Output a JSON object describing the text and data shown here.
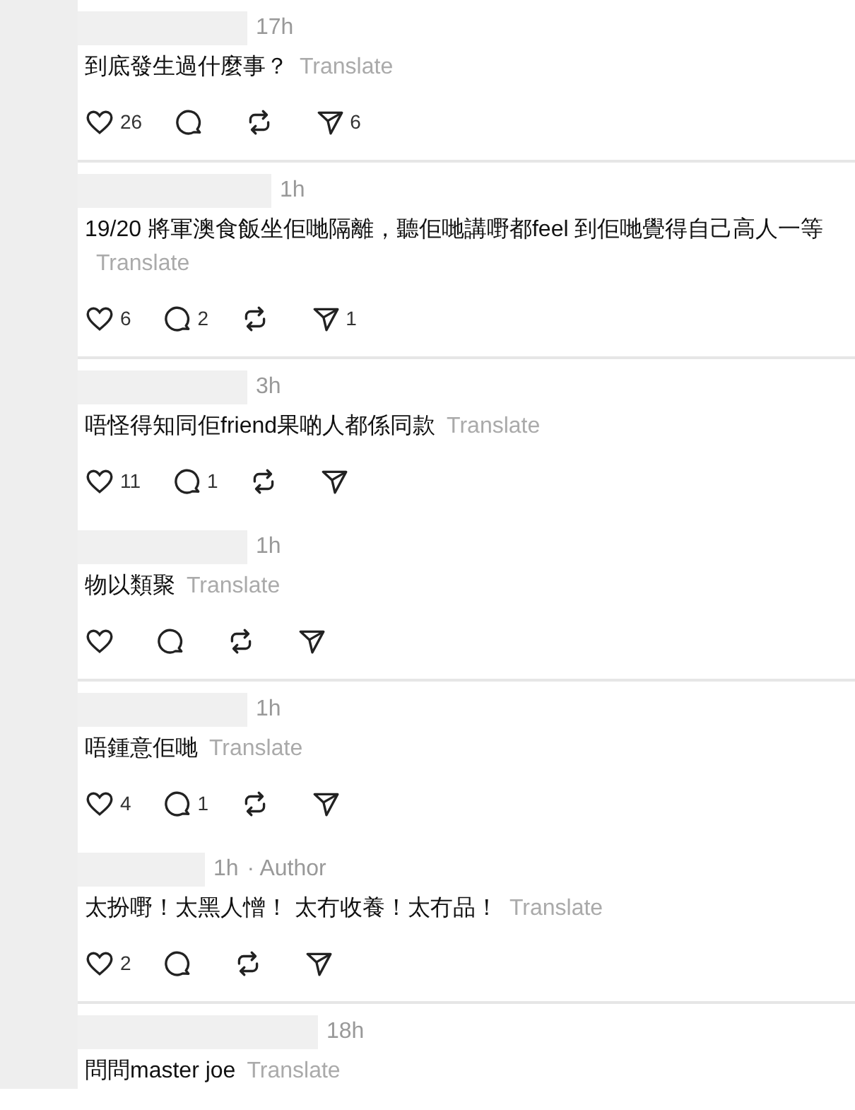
{
  "comments": [
    {
      "time": "17h",
      "text": "到底發生過什麼事？",
      "translate": "Translate",
      "likes": "26",
      "shares": "6",
      "divider_below": true
    },
    {
      "time": "1h",
      "text": "19/20 將軍澳食飯坐佢哋隔離，聽佢哋講嘢都feel 到佢哋覺得自己高人一等",
      "translate": "Translate",
      "likes": "6",
      "replies": "2",
      "shares": "1",
      "divider_below": true
    },
    {
      "time": "3h",
      "text": "唔怪得知同佢friend果啲人都係同款",
      "translate": "Translate",
      "likes": "11",
      "replies": "1",
      "divider_below": false
    },
    {
      "time": "1h",
      "text": "物以類聚",
      "translate": "Translate",
      "divider_below": true
    },
    {
      "time": "1h",
      "text": "唔鍾意佢哋",
      "translate": "Translate",
      "likes": "4",
      "replies": "1",
      "divider_below": false
    },
    {
      "time": "1h",
      "author_label": "· Author",
      "text": "太扮嘢！太黑人憎！ 太冇收養！太冇品！",
      "translate": "Translate",
      "likes": "2",
      "divider_below": true
    },
    {
      "time": "18h",
      "text": "問問master joe",
      "translate": "Translate",
      "divider_below": false,
      "actions_visible": false
    }
  ]
}
